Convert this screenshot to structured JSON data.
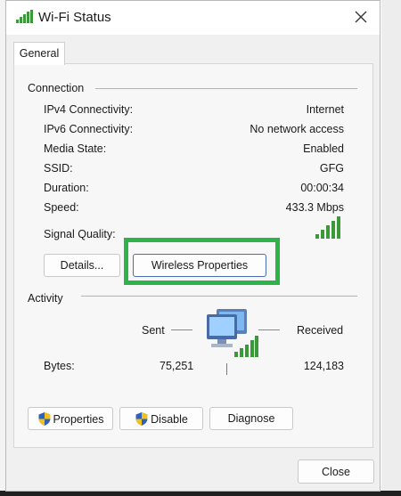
{
  "window": {
    "title": "Wi-Fi Status"
  },
  "tabs": [
    {
      "label": "General"
    }
  ],
  "connection": {
    "header": "Connection",
    "rows": [
      {
        "label": "IPv4 Connectivity:",
        "value": "Internet"
      },
      {
        "label": "IPv6 Connectivity:",
        "value": "No network access"
      },
      {
        "label": "Media State:",
        "value": "Enabled"
      },
      {
        "label": "SSID:",
        "value": "GFG"
      },
      {
        "label": "Duration:",
        "value": "00:00:34"
      },
      {
        "label": "Speed:",
        "value": "433.3 Mbps"
      }
    ],
    "signal_quality_label": "Signal Quality:",
    "signal_bars": 5,
    "details_button": "Details...",
    "wireless_properties_button": "Wireless Properties"
  },
  "activity": {
    "header": "Activity",
    "sent_label": "Sent",
    "received_label": "Received",
    "bytes_label": "Bytes:",
    "bytes_sent": "75,251",
    "bytes_received": "124,183",
    "icon": "network-computers-icon"
  },
  "actions": {
    "properties_button": "Properties",
    "disable_button": "Disable",
    "diagnose_button": "Diagnose",
    "close_button": "Close"
  },
  "colors": {
    "highlight": "#2db34a",
    "signal": "#3a9a3a",
    "shield_blue": "#2e62c2",
    "shield_yellow": "#f2c21b"
  },
  "icons": [
    "wifi-signal-icon",
    "close-icon",
    "signal-quality-icon",
    "network-computers-icon",
    "uac-shield-icon"
  ]
}
